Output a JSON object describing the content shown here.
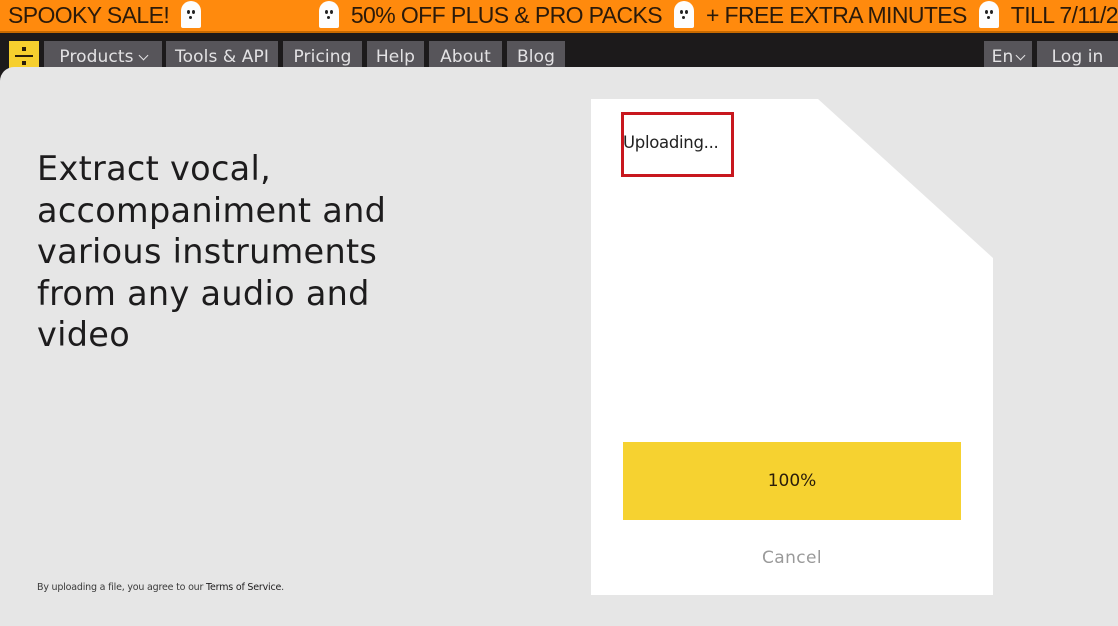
{
  "promo": {
    "segments": [
      "SPOOKY SALE!",
      "50% OFF PLUS & PRO PACKS",
      "+ FREE EXTRA MINUTES",
      "TILL 7/11/2"
    ],
    "icon": "ghost-icon",
    "background_color": "#ff8a0d"
  },
  "nav": {
    "logo_icon": "divide-icon",
    "items": [
      {
        "label": "Products",
        "has_dropdown": true
      },
      {
        "label": "Tools & API"
      },
      {
        "label": "Pricing"
      },
      {
        "label": "Help"
      },
      {
        "label": "About"
      },
      {
        "label": "Blog"
      }
    ],
    "language": {
      "label": "En",
      "has_dropdown": true
    },
    "login_label": "Log in"
  },
  "hero": {
    "headline": "Extract vocal, accompaniment and various instruments from any audio and video"
  },
  "footer": {
    "terms_prefix": "By uploading a file, you agree to our ",
    "terms_link": "Terms of Service",
    "terms_suffix": "."
  },
  "upload": {
    "status": "Uploading...",
    "progress_percent": 100,
    "progress_label": "100%",
    "progress_color": "#f6d230",
    "cancel_label": "Cancel"
  }
}
